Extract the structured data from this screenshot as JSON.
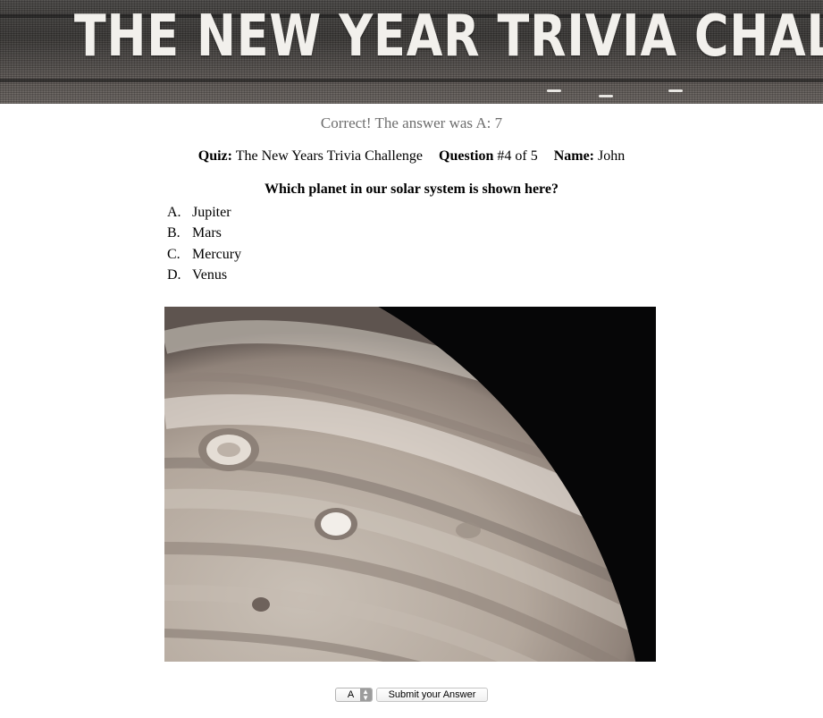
{
  "banner": {
    "title": "THE NEW YEAR TRIVIA CHALLENGE"
  },
  "feedback": "Correct! The answer was A: 7",
  "meta": {
    "quiz_label": "Quiz:",
    "quiz_name": "The New Years Trivia Challenge",
    "question_label": "Question",
    "question_progress": "#4 of 5",
    "name_label": "Name:",
    "name_value": "John"
  },
  "question": "Which planet in our solar system is shown here?",
  "answers": [
    {
      "letter": "A.",
      "text": "Jupiter"
    },
    {
      "letter": "B.",
      "text": "Mars"
    },
    {
      "letter": "C.",
      "text": "Mercury"
    },
    {
      "letter": "D.",
      "text": "Venus"
    }
  ],
  "image": {
    "subject": "jupiter-planet-photo"
  },
  "controls": {
    "selected_answer": "A",
    "submit_label": "Submit your Answer"
  }
}
